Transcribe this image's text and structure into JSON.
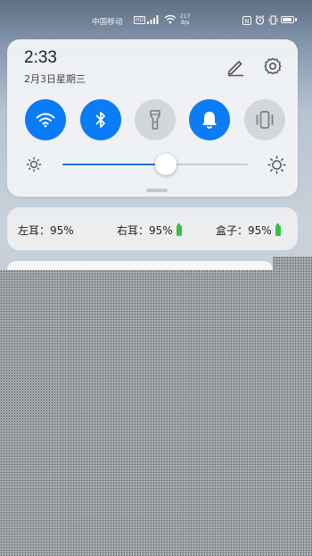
{
  "status_bar": {
    "carrier": "中国移动",
    "network_badge": "HD",
    "net_speed_value": "217",
    "net_speed_unit": "B/s",
    "icons": [
      "nfc-icon",
      "alarm-icon",
      "vibrate-icon",
      "battery-icon"
    ],
    "battery_level": 0.9
  },
  "panel": {
    "time": "2:33",
    "date": "2月3日星期三",
    "toggles": [
      {
        "name": "wifi",
        "icon": "wifi-icon",
        "state": "on"
      },
      {
        "name": "bluetooth",
        "icon": "bluetooth-icon",
        "state": "on"
      },
      {
        "name": "flashlight",
        "icon": "flashlight-icon",
        "state": "off"
      },
      {
        "name": "notification-bell",
        "icon": "bell-icon",
        "state": "on"
      },
      {
        "name": "vibration",
        "icon": "vibrate-icon",
        "state": "off"
      }
    ],
    "brightness": 0.56
  },
  "earbuds": {
    "left_label": "左耳：",
    "left_value": "95%",
    "right_label": "右耳：",
    "right_value": "95%",
    "case_label": "盒子：",
    "case_value": "95%"
  },
  "colors": {
    "accent": "#0a7cf5",
    "toggle_off": "#d3d6da",
    "battery_green": "#3cbf4a"
  }
}
